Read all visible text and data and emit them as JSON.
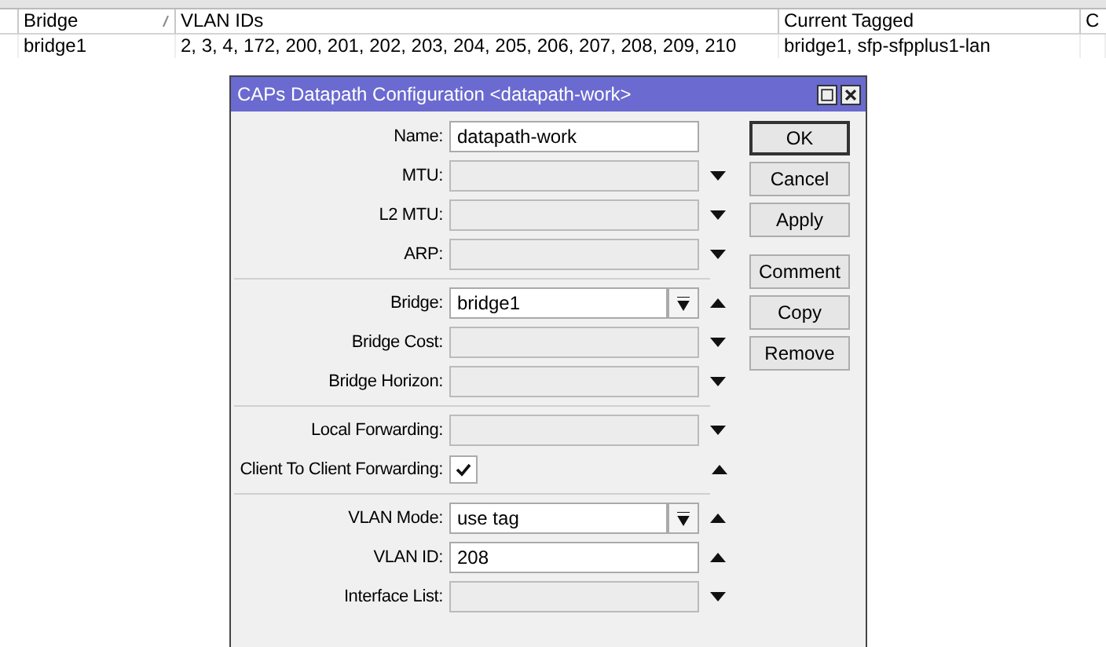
{
  "table": {
    "columns": [
      {
        "label": "Bridge",
        "sorted": true
      },
      {
        "label": "VLAN IDs"
      },
      {
        "label": "Current Tagged"
      },
      {
        "label": "C"
      }
    ],
    "rows": [
      [
        "bridge1",
        "2, 3, 4, 172, 200, 201, 202, 203, 204, 205, 206, 207, 208, 209, 210",
        "bridge1, sfp-sfpplus1-lan"
      ]
    ]
  },
  "dialog": {
    "title": "CAPs Datapath Configuration <datapath-work>",
    "sections": [
      [
        {
          "kind": "text",
          "label": "Name:",
          "value": "datapath-work"
        },
        {
          "kind": "text",
          "label": "MTU:",
          "expanded": false
        },
        {
          "kind": "text",
          "label": "L2 MTU:",
          "expanded": false
        },
        {
          "kind": "text",
          "label": "ARP:",
          "expanded": false
        }
      ],
      [
        {
          "kind": "combo",
          "label": "Bridge:",
          "value": "bridge1",
          "expanded": true
        },
        {
          "kind": "text",
          "label": "Bridge Cost:",
          "expanded": false
        },
        {
          "kind": "text",
          "label": "Bridge Horizon:",
          "expanded": false
        }
      ],
      [
        {
          "kind": "text",
          "label": "Local Forwarding:",
          "expanded": false
        },
        {
          "kind": "check",
          "label": "Client To Client Forwarding:",
          "checked": true,
          "expanded": true
        }
      ],
      [
        {
          "kind": "combo",
          "label": "VLAN Mode:",
          "value": "use tag",
          "expanded": true
        },
        {
          "kind": "text",
          "label": "VLAN ID:",
          "value": "208",
          "expanded": true
        },
        {
          "kind": "text",
          "label": "Interface List:",
          "expanded": false
        }
      ]
    ],
    "buttons": [
      {
        "label": "OK",
        "default": true,
        "gap_before": false
      },
      {
        "label": "Cancel",
        "default": false,
        "gap_before": false
      },
      {
        "label": "Apply",
        "default": false,
        "gap_before": false
      },
      {
        "label": "Comment",
        "default": false,
        "gap_before": true
      },
      {
        "label": "Copy",
        "default": false,
        "gap_before": false
      },
      {
        "label": "Remove",
        "default": false,
        "gap_before": false
      }
    ]
  }
}
